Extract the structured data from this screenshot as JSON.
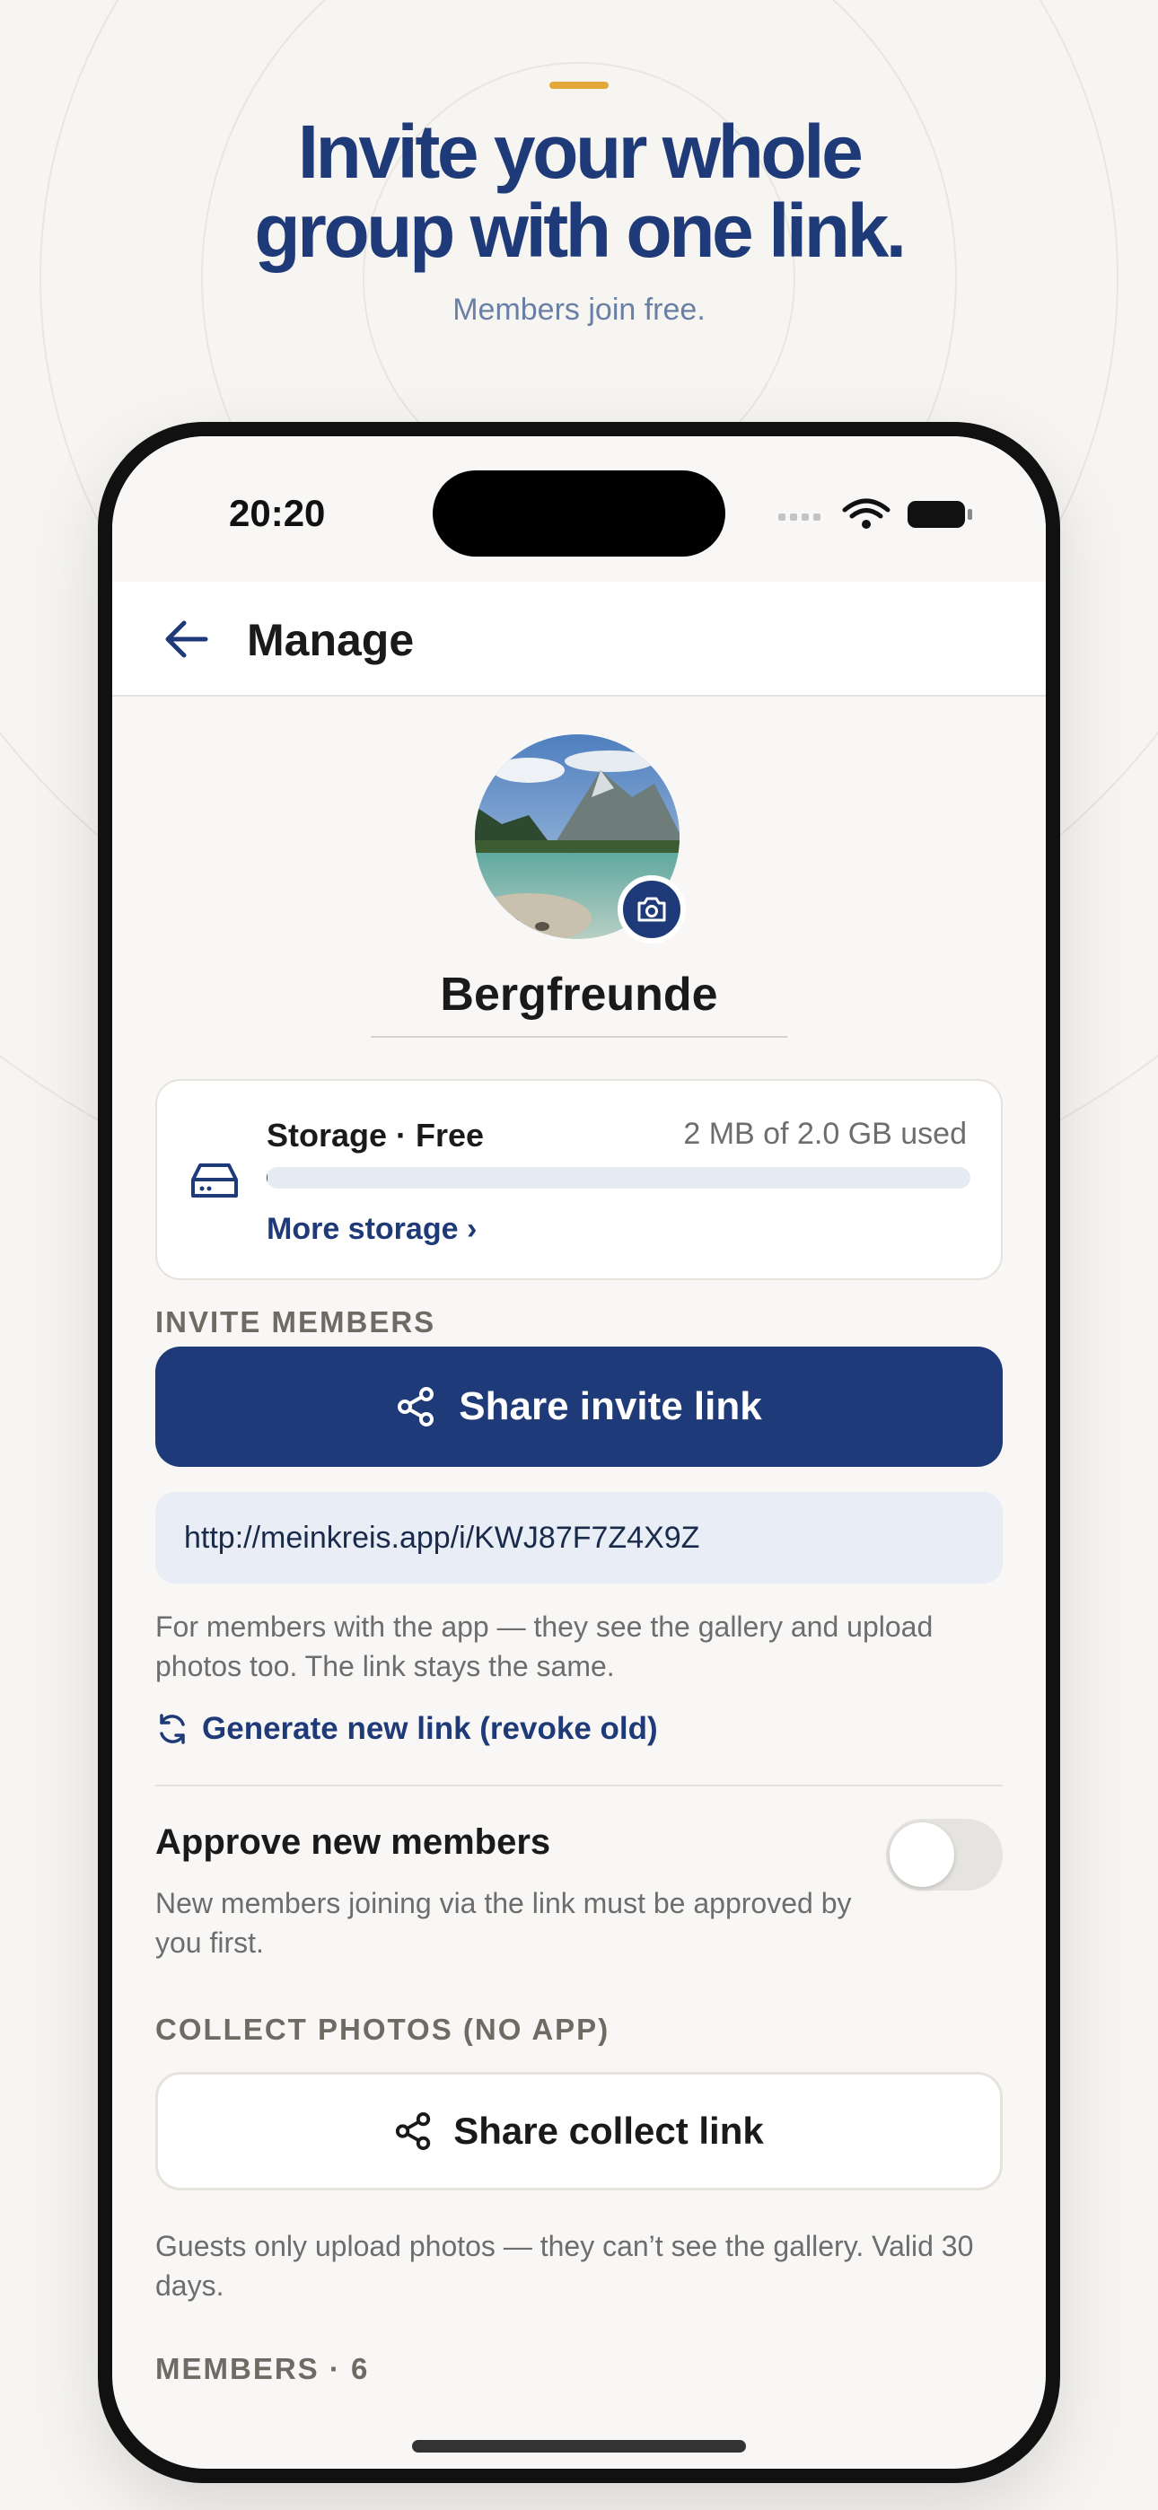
{
  "marketing": {
    "headline_line1": "Invite your whole",
    "headline_line2": "group with one link.",
    "subheadline": "Members join free."
  },
  "status_bar": {
    "time": "20:20"
  },
  "nav": {
    "title": "Manage",
    "back_icon": "arrow-left-icon"
  },
  "group": {
    "name": "Bergfreunde",
    "avatar_icon": "mountain-lake-photo",
    "camera_icon": "camera-icon"
  },
  "storage": {
    "title": "Storage · Free",
    "used_text": "2 MB of 2.0 GB used",
    "used_fraction": 0.001,
    "more_link": "More storage ›",
    "icon": "hard-drive-icon"
  },
  "invite": {
    "section_label": "INVITE MEMBERS",
    "share_button": "Share invite link",
    "link_url": "http://meinkreis.app/i/KWJ87F7Z4X9Z",
    "help_text": "For members with the app — they see the gallery and upload photos too. The link stays the same.",
    "regenerate_link": "Generate new link (revoke old)"
  },
  "approve": {
    "title": "Approve new members",
    "description": "New members joining via the link must be approved by you first.",
    "enabled": false
  },
  "collect": {
    "section_label": "COLLECT PHOTOS (NO APP)",
    "share_button": "Share collect link",
    "help_text": "Guests only upload photos — they can’t see the gallery. Valid 30 days."
  },
  "members": {
    "section_label": "MEMBERS · 6"
  },
  "colors": {
    "brand_navy": "#1f3a78",
    "accent_gold": "#e2a83a",
    "background": "#f8f7f5",
    "link_field_bg": "#e8edf6"
  }
}
